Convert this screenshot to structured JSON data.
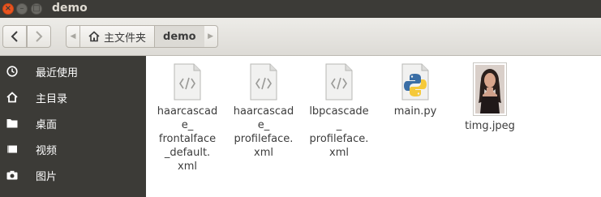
{
  "window": {
    "title": "demo",
    "buttons": {
      "close": "×",
      "minimize": "–",
      "maximize": "□"
    }
  },
  "toolbar": {
    "back_icon": "chevron-left-icon",
    "forward_icon": "chevron-right-icon",
    "path": [
      {
        "label": "主文件夹",
        "icon": "home-icon"
      },
      {
        "label": "demo"
      }
    ]
  },
  "sidebar": {
    "items": [
      {
        "label": "最近使用",
        "icon": "clock-icon"
      },
      {
        "label": "主目录",
        "icon": "home-icon"
      },
      {
        "label": "桌面",
        "icon": "folder-icon"
      },
      {
        "label": "视频",
        "icon": "video-icon"
      },
      {
        "label": "图片",
        "icon": "camera-icon"
      }
    ]
  },
  "files": [
    {
      "name": "haarcascade_frontalface_default.xml",
      "display": "haarcascad\ne_\nfrontalface\n_default.\nxml",
      "icon": "code-file-icon"
    },
    {
      "name": "haarcascade_profileface.xml",
      "display": "haarcascad\ne_\nprofileface.\nxml",
      "icon": "code-file-icon"
    },
    {
      "name": "lbpcascade_profileface.xml",
      "display": "lbpcascade\n_\nprofileface.\nxml",
      "icon": "code-file-icon"
    },
    {
      "name": "main.py",
      "display": "main.py",
      "icon": "python-file-icon"
    },
    {
      "name": "timg.jpeg",
      "display": "timg.jpeg",
      "icon": "image-thumbnail"
    }
  ]
}
